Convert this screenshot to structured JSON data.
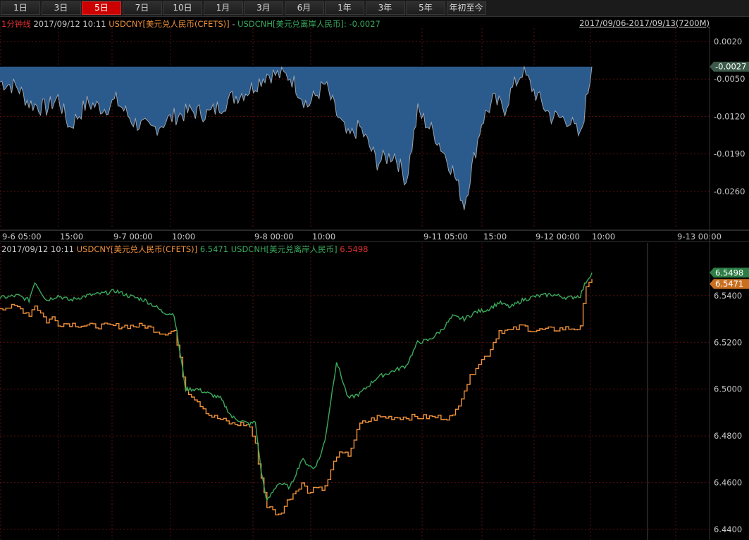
{
  "tabs": [
    {
      "label": "1日",
      "active": false
    },
    {
      "label": "3日",
      "active": false
    },
    {
      "label": "5日",
      "active": true
    },
    {
      "label": "7日",
      "active": false
    },
    {
      "label": "10日",
      "active": false
    },
    {
      "label": "1月",
      "active": false
    },
    {
      "label": "3月",
      "active": false
    },
    {
      "label": "6月",
      "active": false
    },
    {
      "label": "1年",
      "active": false
    },
    {
      "label": "3年",
      "active": false
    },
    {
      "label": "5年",
      "active": false
    },
    {
      "label": "年初至今",
      "active": false
    }
  ],
  "top_legend": {
    "interval": "1分钟线",
    "datetime": "2017/09/12 10:11",
    "formula_a": "USDCNY[美元兑人民币(CFETS)]",
    "minus": "-",
    "formula_b": "USDCNH[美元兑离岸人民币]",
    "value": ": -0.0027",
    "range": "2017/09/06-2017/09/13(7200M)"
  },
  "bottom_legend": {
    "datetime": "2017/09/12 10:11",
    "series_a": "USDCNY[美元兑人民币(CFETS)]",
    "value_a": "6.5471",
    "series_b": "USDCNH[美元兑离岸人民币]",
    "value_b": "6.5498"
  },
  "colors": {
    "cny": "#f0913a",
    "cnh": "#3aaa5c",
    "spread_fill": "#2b5a8c",
    "spread_line": "#9aa4ae",
    "grid": "#5a0f0f"
  },
  "chart_data": [
    {
      "type": "area",
      "title": "USDCNY[美元兑人民币(CFETS)] - USDCNH[美元兑离岸人民币]",
      "last_value": -0.0027,
      "baseline": -0.0027,
      "ylim": [
        -0.033,
        0.0045
      ],
      "yticks": [
        "0.0020",
        "-0.0050",
        "-0.0120",
        "-0.0190",
        "-0.0260"
      ],
      "x_tick_labels": [
        "9-6 05:00",
        "15:00",
        "9-7 00:00",
        "10:00",
        "9-8 00:00",
        "10:00",
        "9-11 05:00",
        "15:00",
        "9-12 00:00",
        "10:00",
        "9-13 00:00"
      ],
      "x": [
        0,
        3,
        5,
        8,
        10,
        12,
        15,
        18,
        20,
        23,
        26,
        30,
        33,
        36,
        40,
        43,
        46,
        50,
        53,
        56,
        58,
        60,
        62,
        65,
        68,
        70,
        72,
        75,
        78,
        80,
        83,
        85,
        87,
        88,
        90,
        93,
        95,
        98,
        100,
        102
      ],
      "values": [
        -0.0055,
        -0.0065,
        -0.0095,
        -0.0105,
        -0.0085,
        -0.014,
        -0.0095,
        -0.0105,
        -0.009,
        -0.013,
        -0.0145,
        -0.012,
        -0.011,
        -0.0115,
        -0.0085,
        -0.007,
        -0.004,
        -0.0045,
        -0.01,
        -0.006,
        -0.0115,
        -0.016,
        -0.014,
        -0.0205,
        -0.019,
        -0.024,
        -0.011,
        -0.0155,
        -0.022,
        -0.0285,
        -0.013,
        -0.009,
        -0.0105,
        -0.0075,
        -0.0035,
        -0.009,
        -0.012,
        -0.0125,
        -0.016,
        -0.0027
      ]
    },
    {
      "type": "line",
      "ylim": [
        6.4355,
        6.5565
      ],
      "yticks": [
        "6.5400",
        "6.5200",
        "6.5000",
        "6.4800",
        "6.4600",
        "6.4400"
      ],
      "x": [
        0,
        3,
        5,
        6,
        8,
        9,
        10,
        12,
        15,
        18,
        20,
        22,
        25,
        27,
        28,
        30,
        32,
        34,
        36,
        38,
        40,
        41,
        42,
        43,
        44,
        45,
        46,
        48,
        50,
        52,
        53,
        54,
        55,
        56,
        58,
        60,
        62,
        65,
        66,
        68,
        70,
        72,
        74,
        76,
        78,
        80,
        82,
        84,
        86,
        88,
        90,
        92,
        95,
        98,
        100,
        101,
        102
      ],
      "series": [
        {
          "name": "USDCNY[美元兑人民币(CFETS)]",
          "values": [
            6.535,
            6.535,
            6.532,
            6.536,
            6.529,
            6.5305,
            6.528,
            6.528,
            6.527,
            6.527,
            6.527,
            6.527,
            6.527,
            6.525,
            6.524,
            6.525,
            6.5,
            6.495,
            6.489,
            6.487,
            6.485,
            6.485,
            6.485,
            6.484,
            6.476,
            6.462,
            6.45,
            6.446,
            6.454,
            6.46,
            6.456,
            6.458,
            6.458,
            6.458,
            6.472,
            6.472,
            6.485,
            6.488,
            6.488,
            6.488,
            6.488,
            6.488,
            6.488,
            6.488,
            6.488,
            6.5,
            6.51,
            6.515,
            6.525,
            6.525,
            6.527,
            6.525,
            6.5255,
            6.526,
            6.526,
            6.545,
            6.5471
          ]
        },
        {
          "name": "USDCNH[美元兑离岸人民币]",
          "values": [
            6.539,
            6.54,
            6.538,
            6.546,
            6.538,
            6.539,
            6.54,
            6.538,
            6.54,
            6.541,
            6.542,
            6.54,
            6.538,
            6.535,
            6.533,
            6.532,
            6.5,
            6.5,
            6.498,
            6.496,
            6.488,
            6.487,
            6.486,
            6.485,
            6.486,
            6.465,
            6.452,
            6.46,
            6.458,
            6.47,
            6.468,
            6.466,
            6.47,
            6.478,
            6.512,
            6.496,
            6.498,
            6.505,
            6.506,
            6.508,
            6.51,
            6.52,
            6.521,
            6.525,
            6.531,
            6.53,
            6.533,
            6.534,
            6.537,
            6.535,
            6.538,
            6.5395,
            6.5405,
            6.539,
            6.54,
            6.546,
            6.5498
          ]
        }
      ]
    }
  ]
}
